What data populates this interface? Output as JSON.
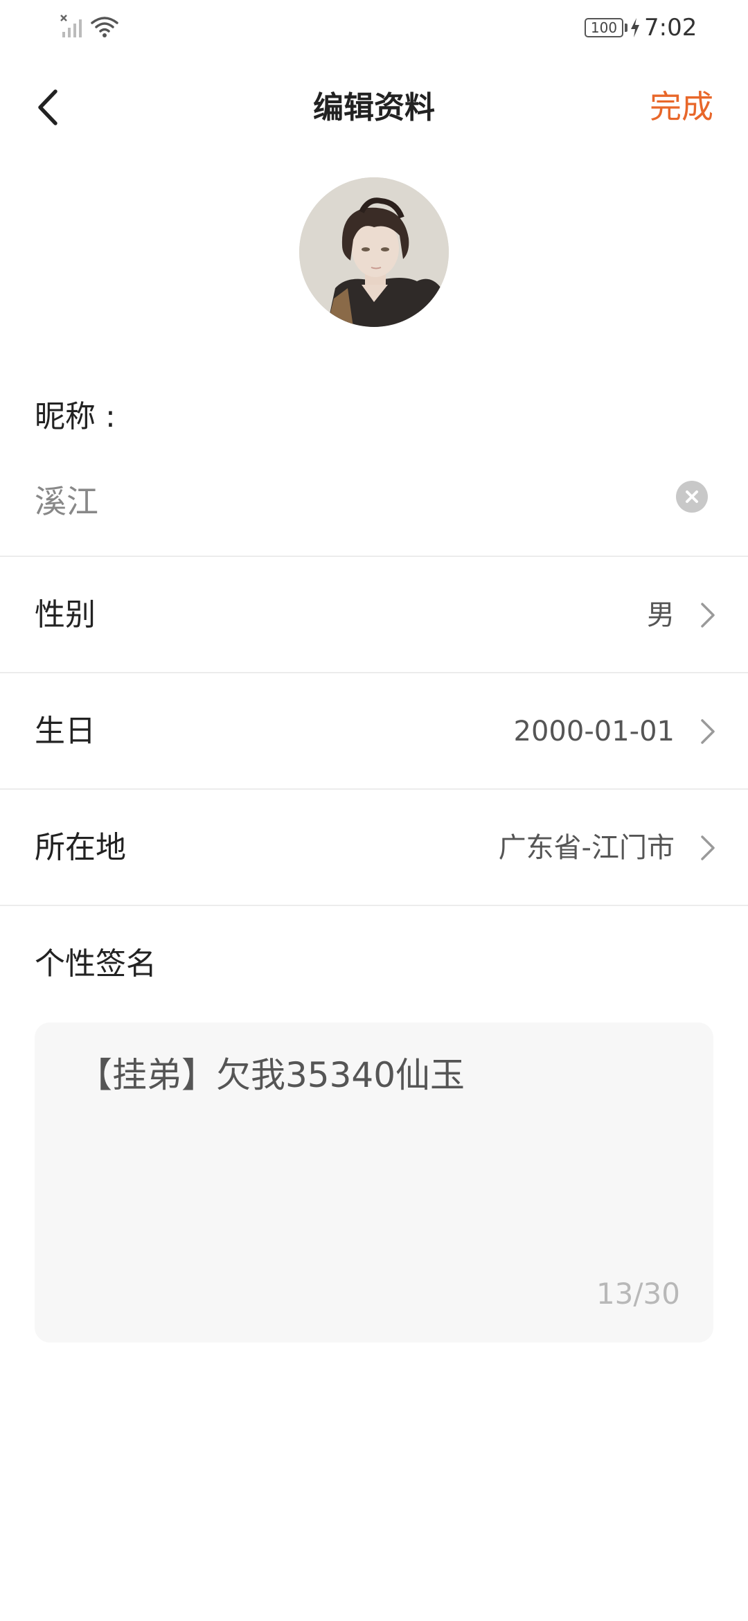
{
  "status_bar": {
    "battery_level": "100",
    "time": "7:02"
  },
  "header": {
    "title": "编辑资料",
    "done_label": "完成"
  },
  "nickname": {
    "label": "昵称 :",
    "value": "溪江"
  },
  "rows": [
    {
      "label": "性别",
      "value": "男"
    },
    {
      "label": "生日",
      "value": "2000-01-01"
    },
    {
      "label": "所在地",
      "value": "广东省-江门市"
    }
  ],
  "signature": {
    "label": "个性签名",
    "text": "【挂弟】欠我35340仙玉",
    "count": "13/30"
  },
  "colors": {
    "accent": "#e8672a",
    "divider": "#ececec",
    "textarea_bg": "#f7f7f7"
  },
  "icons": {
    "back": "chevron-left-icon",
    "clear": "clear-icon",
    "row_arrow": "chevron-right-icon"
  }
}
